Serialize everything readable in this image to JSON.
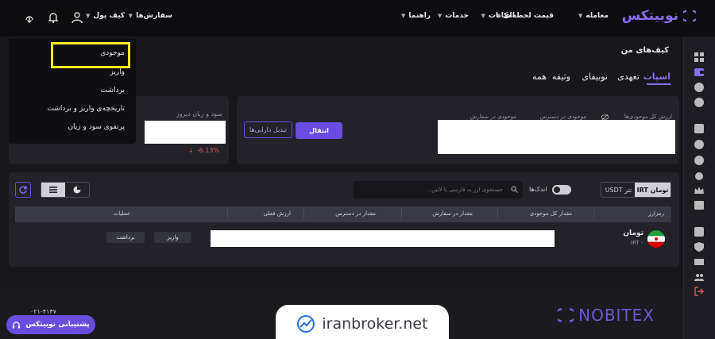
{
  "brand": {
    "name": "نوبیتکس"
  },
  "nav": {
    "trade": "معامله",
    "prices": "قیمت لحظه‌ای",
    "features": "امکانات",
    "services": "خدمات",
    "guide": "راهنما",
    "orders": "سفارش‌ها",
    "wallet": "کیف پول"
  },
  "dropdown": {
    "items": [
      "موجودی",
      "واریز",
      "برداشت",
      "تاریخچه‌ی واریز و برداشت",
      "پرتفوی سود و زیان"
    ]
  },
  "page": {
    "title": "کیف‌های من"
  },
  "tabs": [
    "اسپات",
    "تعهدی",
    "نوبیفای",
    "وثیقه",
    "همه"
  ],
  "summary": {
    "total_value": "ارزش کل موجودی‌ها",
    "available": "موجودی در دسترس",
    "in_order": "موجودی در سفارش",
    "transfer": "انتقال",
    "convert": "تبدیل دارایی‌ها",
    "pnl_label": "سود و زیان دیروز",
    "pnl_value": "-6.13%"
  },
  "filters": {
    "currency_irt": "تومان IRT",
    "currency_usdt": "تتر USDT",
    "small_toggle": "اندک‌ها",
    "search_placeholder": "جستجوی ارز به فارسی یا لاتین..."
  },
  "table": {
    "headers": [
      "رمزارز",
      "مقدار کل موجودی",
      "مقدار در سفارش",
      "مقدار در دسترس",
      "ارزش فعلی",
      "عملیات"
    ],
    "row": {
      "name": "تومان",
      "code": "IRT -",
      "deposit": "واریز",
      "withdraw": "برداشت"
    }
  },
  "footer": {
    "logo_text": "NOBITEX",
    "support": "پشتیبانی نوبیتکس",
    "watermark": "iranbroker.net",
    "number": "۰۲۱-۴۱۴۷"
  },
  "colors": {
    "accent": "#6a4de0",
    "negative": "#e05a5a",
    "highlight": "#f7ef20"
  }
}
